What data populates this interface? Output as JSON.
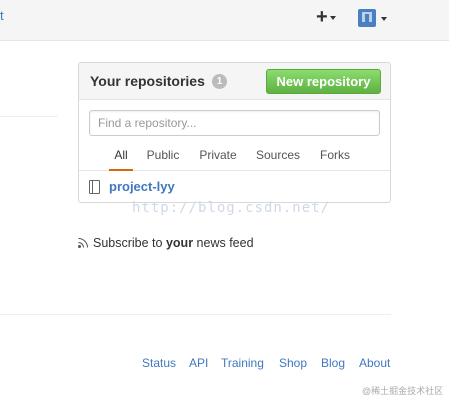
{
  "header": {
    "cut_link_text": "t",
    "plus_glyph": "+"
  },
  "repositories": {
    "title": "Your repositories",
    "count": "1",
    "new_button_label": "New repository",
    "filter_placeholder": "Find a repository...",
    "tabs": [
      "All",
      "Public",
      "Private",
      "Sources",
      "Forks"
    ],
    "selected_tab": "All",
    "items": [
      {
        "name": "project-lyy",
        "icon": "repo-icon"
      }
    ]
  },
  "news_feed": {
    "prefix": "Subscribe to ",
    "bold": "your",
    "suffix": " news feed",
    "icon": "rss-icon"
  },
  "footer": {
    "links": [
      "Status",
      "API",
      "Training",
      "Shop",
      "Blog",
      "About"
    ]
  },
  "watermark": "http://blog.csdn.net/",
  "corner_watermark": "@稀土掘金技术社区",
  "colors": {
    "link": "#4078c0",
    "button_green": "#60b044",
    "tab_underline": "#d26911"
  }
}
